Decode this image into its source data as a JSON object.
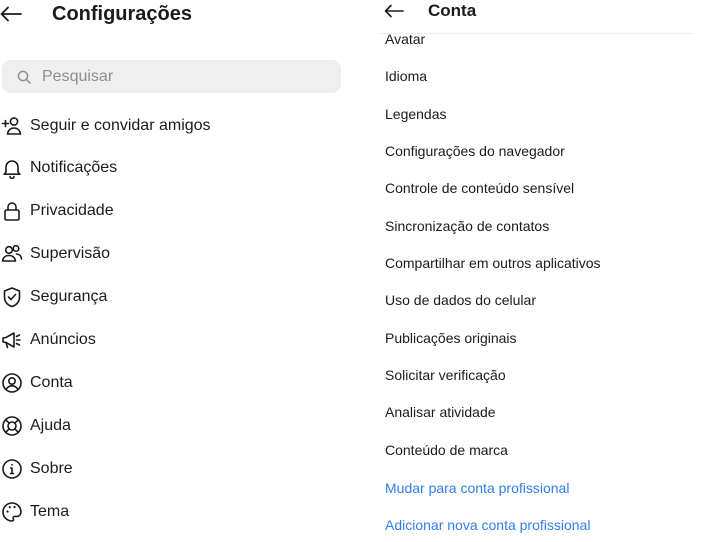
{
  "settings": {
    "title": "Configurações",
    "search_placeholder": "Pesquisar",
    "items": [
      {
        "label": "Seguir e convidar amigos",
        "icon": "add-person-icon"
      },
      {
        "label": "Notificações",
        "icon": "bell-icon"
      },
      {
        "label": "Privacidade",
        "icon": "lock-icon"
      },
      {
        "label": "Supervisão",
        "icon": "people-icon"
      },
      {
        "label": "Segurança",
        "icon": "shield-check-icon"
      },
      {
        "label": "Anúncios",
        "icon": "megaphone-icon"
      },
      {
        "label": "Conta",
        "icon": "account-circle-icon"
      },
      {
        "label": "Ajuda",
        "icon": "lifebuoy-icon"
      },
      {
        "label": "Sobre",
        "icon": "info-icon"
      },
      {
        "label": "Tema",
        "icon": "palette-icon"
      }
    ]
  },
  "account": {
    "title": "Conta",
    "options": [
      {
        "label": "Avatar"
      },
      {
        "label": "Idioma"
      },
      {
        "label": "Legendas"
      },
      {
        "label": "Configurações do navegador"
      },
      {
        "label": "Controle de conteúdo sensível"
      },
      {
        "label": "Sincronização de contatos"
      },
      {
        "label": "Compartilhar em outros aplicativos"
      },
      {
        "label": "Uso de dados do celular"
      },
      {
        "label": "Publicações originais"
      },
      {
        "label": "Solicitar verificação"
      },
      {
        "label": "Analisar atividade"
      },
      {
        "label": "Conteúdo de marca"
      },
      {
        "label": "Mudar para conta profissional",
        "link": true
      },
      {
        "label": "Adicionar nova conta profissional",
        "link": true
      }
    ]
  },
  "colors": {
    "link": "#2f7ef0",
    "text": "#1b1b1b",
    "search_bg": "#efefef"
  }
}
